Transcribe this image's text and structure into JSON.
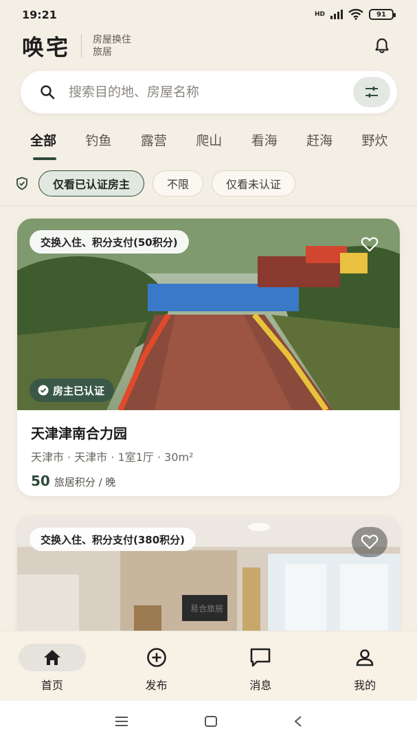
{
  "status_bar": {
    "time": "19:21",
    "battery": "91",
    "network": "HD"
  },
  "header": {
    "logo": "唤宅",
    "tagline_line1": "房屋换住",
    "tagline_line2": "旅居"
  },
  "search": {
    "placeholder": "搜索目的地、房屋名称"
  },
  "tabs": [
    "全部",
    "钓鱼",
    "露营",
    "爬山",
    "看海",
    "赶海",
    "野炊"
  ],
  "verify_filters": {
    "options": [
      "仅看已认证房主",
      "不限",
      "仅看未认证"
    ],
    "selected": "仅看已认证房主"
  },
  "listings": [
    {
      "badge": "交换入住、积分支付(50积分)",
      "verified_label": "房主已认证",
      "title": "天津津南合力园",
      "subtitle": "天津市 · 天津市 · 1室1厅 · 30m²",
      "price": "50",
      "price_unit": "旅居积分 / 晚"
    },
    {
      "badge": "交换入住、积分支付(380积分)",
      "watermark": "易合旅居"
    }
  ],
  "bottom_nav": [
    {
      "label": "首页",
      "icon": "home-icon",
      "active": true
    },
    {
      "label": "发布",
      "icon": "add-circle-icon",
      "active": false
    },
    {
      "label": "消息",
      "icon": "message-icon",
      "active": false
    },
    {
      "label": "我的",
      "icon": "profile-icon",
      "active": false
    }
  ],
  "colors": {
    "accent": "#2f4a3c",
    "background": "#f4efe5",
    "verified_badge": "#3a5848"
  }
}
